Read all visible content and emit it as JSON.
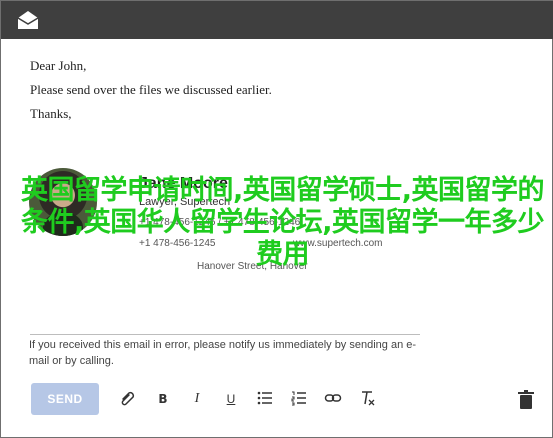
{
  "email": {
    "greeting": "Dear John,",
    "body": "Please send over the files we discussed earlier.",
    "closing": "Thanks,"
  },
  "signature": {
    "name": "Jane Moore",
    "role": "Lawyer, Supertech",
    "phone": "+1 478-456-1245 / +1 478-456-1246",
    "fax": "+1 478-456-1245",
    "website": "www.supertech.com",
    "address": "Hanover Street, Hanover"
  },
  "overlay": {
    "text": "英国留学申请时间,英国留学硕士,英国留学的条件,英国华人留学生论坛,英国留学一年多少费用"
  },
  "disclaimer": {
    "text": "If you received this email in error, please notify us immediately by sending an e-mail or by calling."
  },
  "toolbar": {
    "send_label": "SEND",
    "bold_label": "B",
    "italic_label": "I",
    "underline_label": "U"
  },
  "colors": {
    "titlebar": "#3f3f3f",
    "send_button": "#b6c7e6",
    "overlay_text": "#1fcc1f"
  }
}
